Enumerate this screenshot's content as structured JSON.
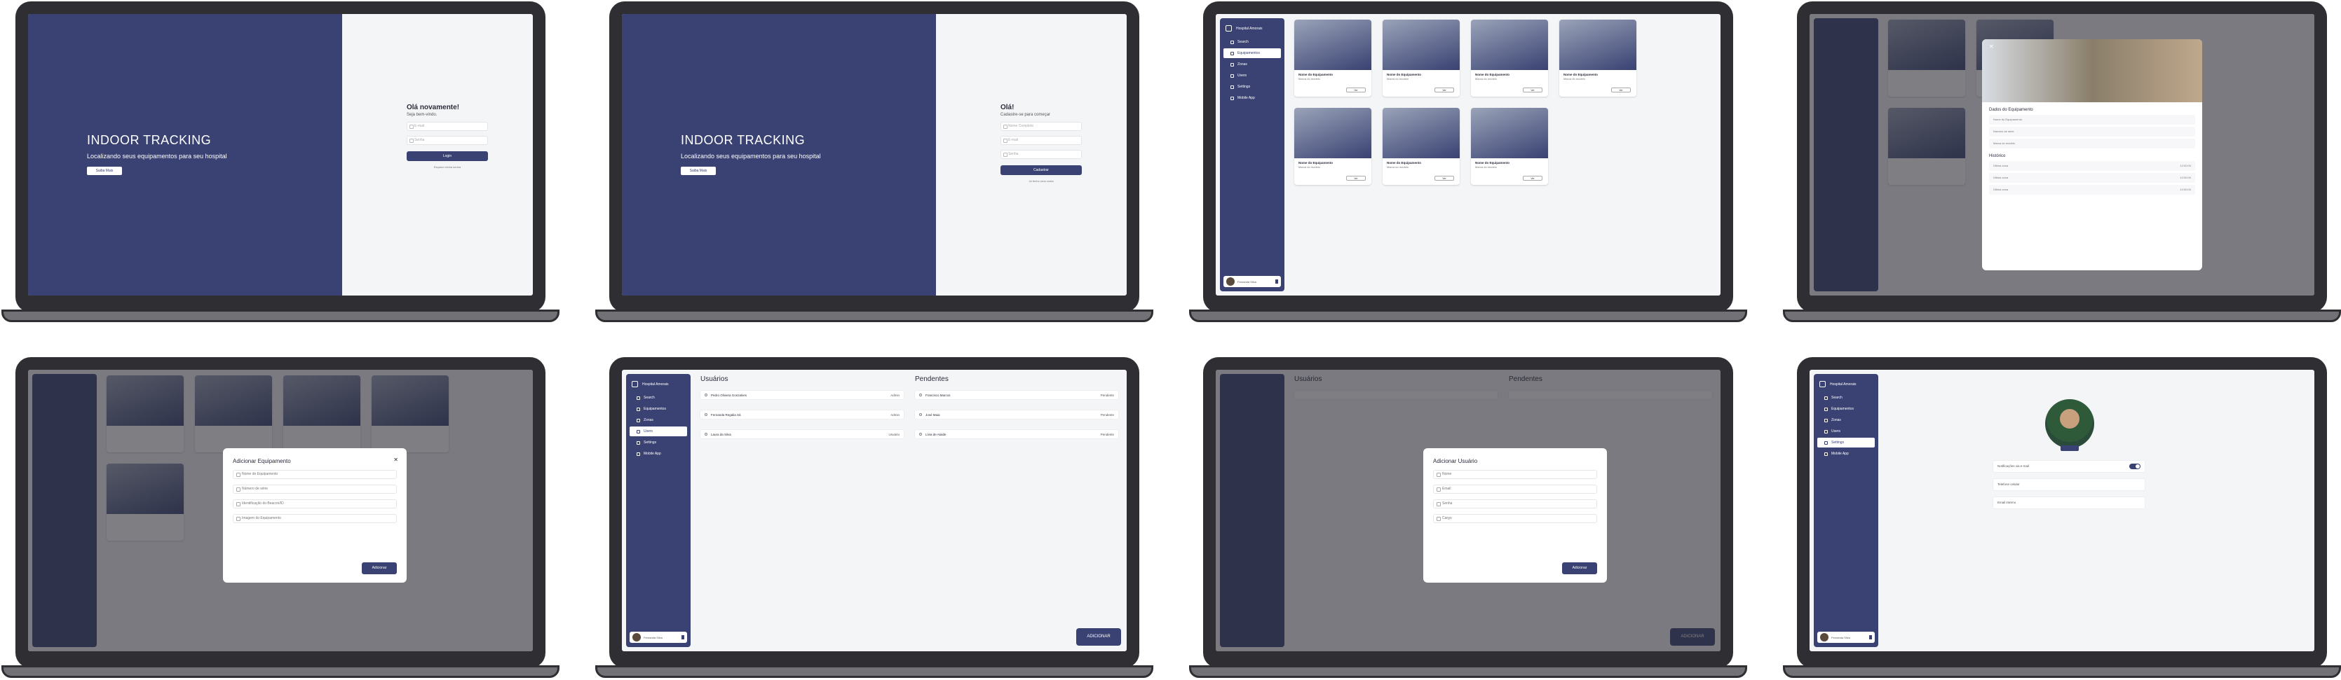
{
  "login": {
    "hero_title": "INDOOR TRACKING",
    "hero_subtitle": "Localizando seus equipamentos para seu hospital",
    "hero_button": "Saiba Mais",
    "form_title": "Olá novamente!",
    "form_subtitle": "Seja bem-vindo.",
    "email_placeholder": "E-mail",
    "password_placeholder": "Senha",
    "login_button": "Login",
    "forgot_link": "Esqueci minha senha"
  },
  "register": {
    "form_title": "Olá!",
    "form_subtitle": "Cadastre-se para começar",
    "name_placeholder": "Nome Completo",
    "email_placeholder": "E-mail",
    "password_placeholder": "Senha",
    "register_button": "Cadastrar",
    "login_link": "Já tenho uma conta"
  },
  "sidebar": {
    "brand": "Hospital Amorais",
    "items": [
      "Search",
      "Equipamentos",
      "Zonas",
      "Users",
      "Settings",
      "Mobile App"
    ],
    "user_name": "Fernanda Silva"
  },
  "equipment": {
    "card_name": "Nome do Equipamento",
    "card_sub": "Marca do modelo",
    "view_button": "Ver"
  },
  "detail": {
    "section1": "Dados do Equipamento",
    "fields": [
      "Nome do Equipamento",
      "Número de série",
      "Marca do modelo"
    ],
    "section2": "Histórico",
    "history": [
      "Última zona",
      "Última zona",
      "Última zona"
    ],
    "history_time": "12:00:00"
  },
  "add_equipment": {
    "title": "Adicionar Equipamento",
    "fields": [
      "Nome do Equipamento",
      "Número de série",
      "Identificação do Beacon/ID",
      "Imagem do Equipamento"
    ],
    "button": "Adicionar"
  },
  "users": {
    "title": "Usuários",
    "pending_title": "Pendentes",
    "list": [
      {
        "name": "Pedro Oliveira Gonzalves",
        "role": "Admin"
      },
      {
        "name": "Fernanda Regalia Sá",
        "role": "Admin"
      },
      {
        "name": "Laura da Silva",
        "role": "Usuário"
      }
    ],
    "pending": [
      {
        "name": "Francisco Marcos",
        "role": "Pendente"
      },
      {
        "name": "José Maia",
        "role": "Pendente"
      },
      {
        "name": "Lívia de Ataide",
        "role": "Pendente"
      }
    ],
    "add_button": "ADICIONAR"
  },
  "add_user": {
    "title": "Adicionar Usuário",
    "fields": [
      "Nome",
      "Email",
      "Senha",
      "Cargo"
    ],
    "button": "Adicionar"
  },
  "settings": {
    "notif": "Notificações via e-mail",
    "phone": "Telefone celular",
    "email": "Email interno"
  }
}
